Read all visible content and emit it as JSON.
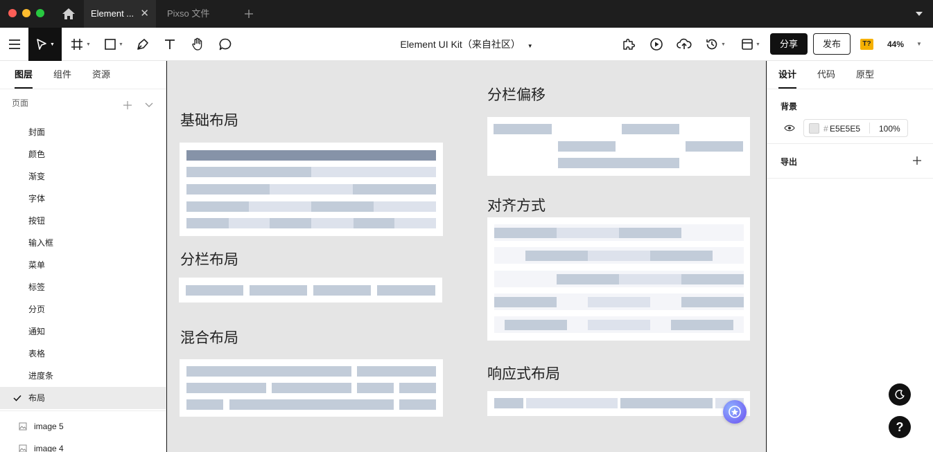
{
  "titlebar": {
    "tabs": [
      {
        "label": "Element ..."
      },
      {
        "label": "Pixso 文件"
      }
    ]
  },
  "toolbar": {
    "doc_title": "Element UI Kit（来自社区）",
    "share_label": "分享",
    "publish_label": "发布",
    "font_badge": "T?",
    "zoom": "44%"
  },
  "left_panel": {
    "tabs": [
      "图层",
      "组件",
      "资源"
    ],
    "pages_header": "页面",
    "pages": [
      "封面",
      "颜色",
      "渐变",
      "字体",
      "按钮",
      "输入框",
      "菜单",
      "标签",
      "分页",
      "通知",
      "表格",
      "进度条",
      "布局"
    ],
    "selected_page": "布局",
    "layers": [
      "image 5",
      "image 4"
    ]
  },
  "canvas": {
    "sections": {
      "basic": "基础布局",
      "columns": "分栏布局",
      "mixed": "混合布局",
      "offset": "分栏偏移",
      "align": "对齐方式",
      "responsive": "响应式布局"
    }
  },
  "right_panel": {
    "tabs": [
      "设计",
      "代码",
      "原型"
    ],
    "background_label": "背景",
    "hash": "#",
    "bg_color": "E5E5E5",
    "bg_opacity": "100%",
    "export_label": "导出"
  },
  "colors": {
    "accent_dark": "#111111",
    "bar_dark": "#8693a8",
    "bar_mid": "#c2ccd9",
    "bar_light": "#dde2ec",
    "canvas_bg": "#e5e5e5",
    "badge": "#f5b000"
  }
}
